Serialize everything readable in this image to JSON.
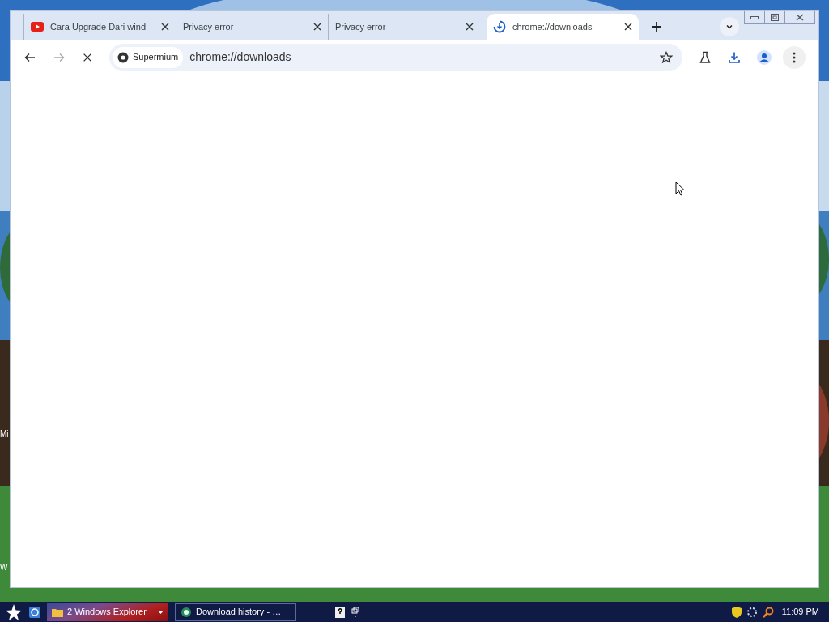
{
  "tabs": [
    {
      "title": "Cara Upgrade Dari wind",
      "kind": "video",
      "selected": false
    },
    {
      "title": "Privacy error",
      "kind": "plain",
      "selected": false
    },
    {
      "title": "Privacy error",
      "kind": "plain",
      "selected": false
    },
    {
      "title": "chrome://downloads",
      "kind": "download",
      "selected": true
    }
  ],
  "toolbar": {
    "loading": true,
    "site_chip": "Supermium",
    "address": "chrome://downloads"
  },
  "desktop_labels": [
    "Mi",
    "W"
  ],
  "taskbar": {
    "buttons": [
      {
        "label": "2 Windows Explorer",
        "kind": "group",
        "selected": false
      },
      {
        "label": "Download history - …",
        "kind": "window",
        "selected": true
      }
    ],
    "clock": "11:09 PM"
  }
}
